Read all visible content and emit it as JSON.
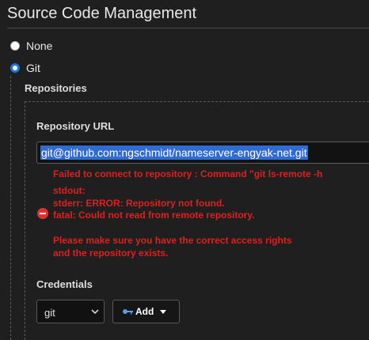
{
  "section": {
    "title": "Source Code Management"
  },
  "scm_options": [
    {
      "label": "None",
      "selected": false
    },
    {
      "label": "Git",
      "selected": true
    }
  ],
  "repositories": {
    "heading": "Repositories",
    "url_label": "Repository URL",
    "url_value": "git@github.com:ngschmidt/nameserver-engyak-net.git",
    "error_lines": [
      "Failed to connect to repository : Command \"git ls-remote -h",
      "stdout:",
      "stderr: ERROR: Repository not found.",
      "fatal: Could not read from remote repository.",
      "",
      "Please make sure you have the correct access rights",
      "and the repository exists."
    ],
    "error_icon": "error-circle-icon"
  },
  "credentials": {
    "label": "Credentials",
    "selected": "git",
    "add_label": "Add",
    "add_icon": "key-icon"
  },
  "colors": {
    "background": "#1f1f1f",
    "error": "#dd2020",
    "selection": "#2f6bd0",
    "radio_accent": "#1a73e8"
  }
}
